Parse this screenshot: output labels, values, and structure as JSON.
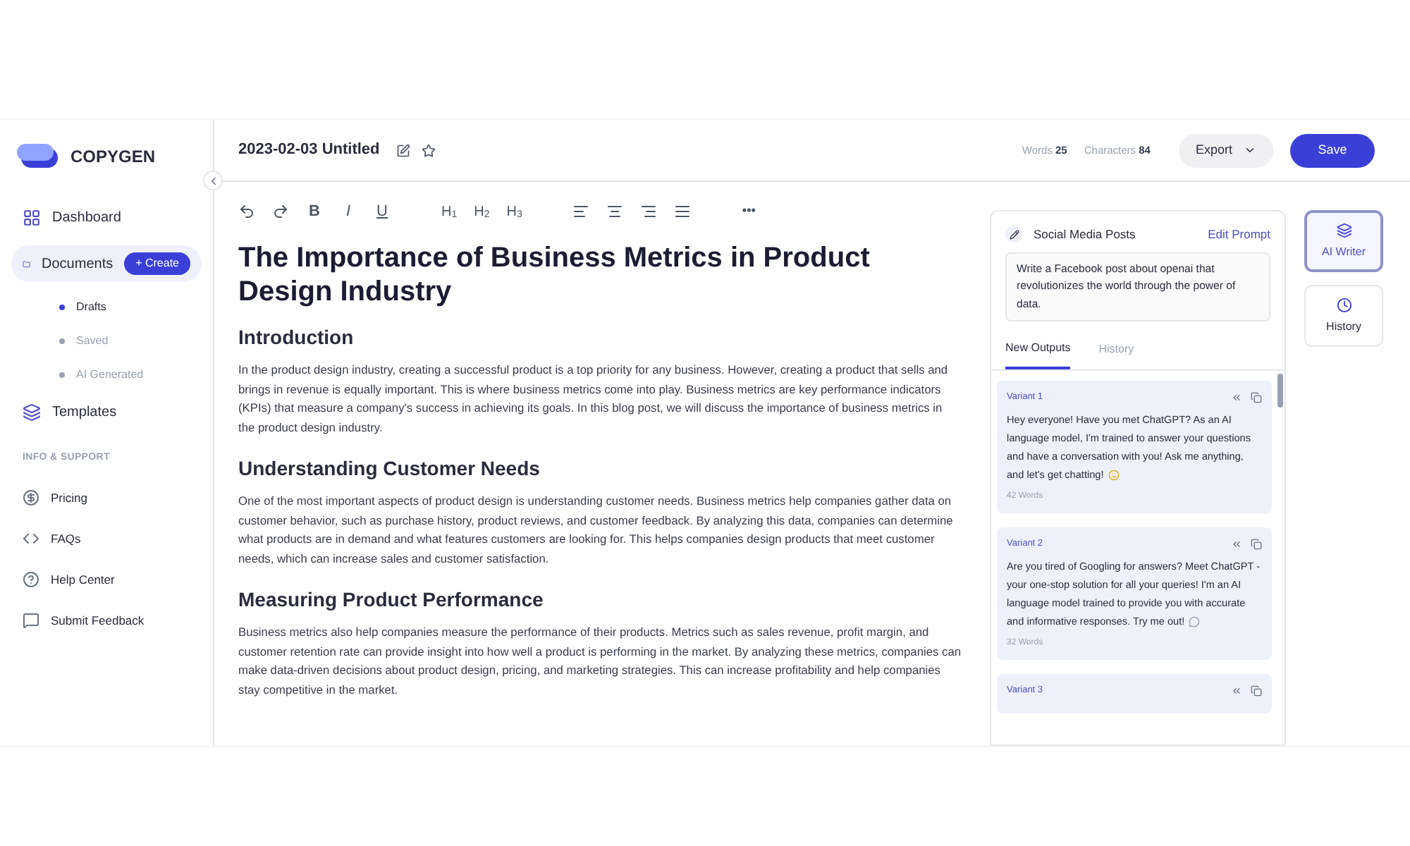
{
  "brand": {
    "name": "COPYGEN"
  },
  "sidebar": {
    "items": [
      {
        "label": "Dashboard",
        "selected": false
      },
      {
        "label": "Documents",
        "selected": true,
        "action": "+ Create",
        "children": [
          {
            "label": "Drafts",
            "selected": true
          },
          {
            "label": "Saved",
            "selected": false
          },
          {
            "label": "AI Generated",
            "selected": false
          }
        ]
      },
      {
        "label": "Templates",
        "selected": false
      }
    ],
    "section_title": "INFO & SUPPORT",
    "support_items": [
      {
        "label": "Pricing"
      },
      {
        "label": "FAQs"
      },
      {
        "label": "Help Center"
      },
      {
        "label": "Submit Feedback"
      }
    ]
  },
  "document": {
    "title": "2023-02-03 Untitled",
    "words_label": "Words",
    "words": "25",
    "characters_label": "Characters",
    "characters": "84",
    "export": "Export",
    "save": "Save"
  },
  "toolbar": [
    {
      "kind": "undo"
    },
    {
      "kind": "redo"
    },
    {
      "kind": "bold",
      "label": "B"
    },
    {
      "kind": "italic",
      "label": "I"
    },
    {
      "kind": "underline",
      "label": "U"
    },
    {
      "kind": "gap"
    },
    {
      "kind": "heading",
      "label": "H",
      "sub": "1"
    },
    {
      "kind": "heading",
      "label": "H",
      "sub": "2"
    },
    {
      "kind": "heading",
      "label": "H",
      "sub": "3"
    },
    {
      "kind": "gap"
    },
    {
      "kind": "alignleft"
    },
    {
      "kind": "aligncenter"
    },
    {
      "kind": "alignright"
    },
    {
      "kind": "alignjustify"
    },
    {
      "kind": "gap"
    },
    {
      "kind": "more",
      "label": "•••"
    }
  ],
  "content": [
    {
      "kind": "title",
      "text": "The Importance of Business Metrics in Product Design Industry"
    },
    {
      "kind": "heading",
      "text": "Introduction"
    },
    {
      "kind": "paragraph",
      "text": "In the product design industry, creating a successful product is a top priority for any business. However, creating a product that sells and brings in revenue is equally important. This is where business metrics come into play. Business metrics are key performance indicators (KPIs) that measure a company's success in achieving its goals. In this blog post, we will discuss the importance of business metrics in the product design industry."
    },
    {
      "kind": "heading",
      "text": "Understanding Customer Needs"
    },
    {
      "kind": "paragraph",
      "text": "One of the most important aspects of product design is understanding customer needs. Business metrics help companies gather data on customer behavior, such as purchase history, product reviews, and customer feedback. By analyzing this data, companies can determine what products are in demand and what features customers are looking for. This helps companies design products that meet customer needs, which can increase sales and customer satisfaction."
    },
    {
      "kind": "heading",
      "text": "Measuring Product Performance"
    },
    {
      "kind": "paragraph",
      "text": "Business metrics also help companies measure the performance of their products. Metrics such as sales revenue, profit margin, and customer retention rate can provide insight into how well a product is performing in the market. By analyzing these metrics, companies can make data-driven decisions about product design, pricing, and marketing strategies. This can increase profitability and help companies stay competitive in the market."
    }
  ],
  "ai_panel": {
    "template": "Social Media Posts",
    "edit": "Edit Prompt",
    "prompt": "Write a Facebook post about openai that revolutionizes the world through the power of data.",
    "tabs": [
      {
        "label": "New Outputs",
        "selected": true
      },
      {
        "label": "History",
        "selected": false
      }
    ],
    "variants": [
      {
        "label": "Variant 1",
        "text": "Hey everyone! Have you met ChatGPT? As an AI language model, I'm trained to answer your questions and have a conversation with you! Ask me anything, and let's get chatting!",
        "words": "42 Words"
      },
      {
        "label": "Variant 2",
        "text": "Are you tired of Googling for answers? Meet ChatGPT - your one-stop solution for all your queries! I'm an AI language model trained to provide you with accurate and informative responses. Try me out!",
        "words": "32 Words"
      },
      {
        "label": "Variant 3"
      }
    ]
  },
  "side_tabs": [
    {
      "label": "AI Writer",
      "selected": true
    },
    {
      "label": "History",
      "selected": false
    }
  ]
}
